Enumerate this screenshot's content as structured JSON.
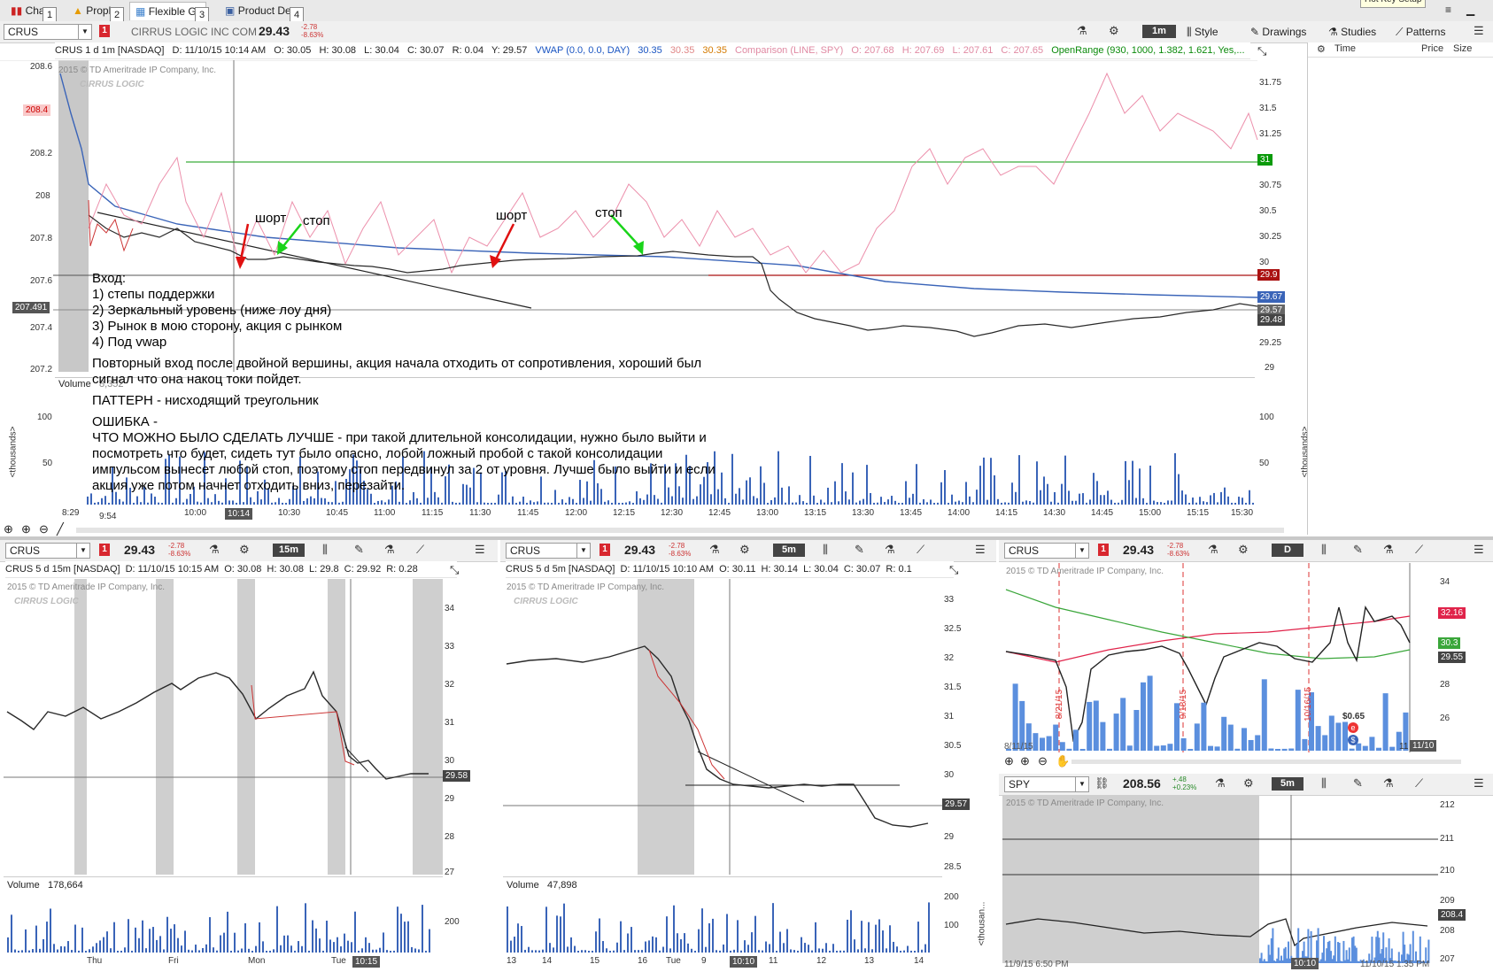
{
  "tabs": [
    {
      "label": "Char",
      "num": "1",
      "icon": "chart-icon"
    },
    {
      "label": "Proph",
      "num": "2",
      "icon": "warning-icon"
    },
    {
      "label": "Flexible Gr",
      "num": "3",
      "icon": "grid-icon"
    },
    {
      "label": "Product Dep",
      "num": "4",
      "icon": "book-icon"
    }
  ],
  "hotkey": "Hot Key Setup",
  "main": {
    "symbol": "CRUS",
    "alert_num": "1",
    "company": "CIRRUS LOGIC INC COM",
    "price": "29.43",
    "change": "-2.78",
    "change_pct": "-8.63%",
    "aggregation": "1m",
    "buttons": {
      "style": "Style",
      "drawings": "Drawings",
      "studies": "Studies",
      "patterns": "Patterns"
    },
    "info": {
      "desc": "CRUS 1 d 1m [NASDAQ]",
      "d": "D: 11/10/15 10:14 AM",
      "o": "O: 30.05",
      "h": "H: 30.08",
      "l": "L: 30.04",
      "c": "C: 30.07",
      "r": "R: 0.04",
      "y": "Y: 29.57",
      "vwap": "VWAP (0.0, 0.0, DAY)",
      "vwap1": "30.35",
      "vwap2": "30.35",
      "vwap3": "30.35",
      "comparison": "Comparison (LINE, SPY)",
      "co": "O: 207.68",
      "ch": "H: 207.69",
      "cl": "L: 207.61",
      "cc": "C: 207.65",
      "openrange": "OpenRange (930, 1000, 1.382, 1.621, Yes,..."
    },
    "copyright": "2015 © TD Ameritrade IP Company, Inc.",
    "logo": "CIRRUS LOGIC",
    "left_axis": [
      "208.6",
      "208.4",
      "208.2",
      "208",
      "207.8",
      "207.6",
      "207.491",
      "207.4",
      "207.2"
    ],
    "right_axis": [
      "31.75",
      "31.5",
      "31.25",
      "31",
      "30.75",
      "30.5",
      "30.25",
      "30",
      "29.9",
      "29.67",
      "29.57",
      "29.48",
      "29.25",
      "29"
    ],
    "time_axis": [
      "8:29",
      "9:54",
      "10:00",
      "10:14",
      "10:30",
      "10:45",
      "11:00",
      "11:15",
      "11:30",
      "11:45",
      "12:00",
      "12:15",
      "12:30",
      "12:45",
      "13:00",
      "13:15",
      "13:30",
      "13:45",
      "14:00",
      "14:15",
      "14:30",
      "14:45",
      "15:00",
      "15:15",
      "15:30"
    ],
    "volume_label": "Volume",
    "volume_value": "8,352",
    "volume_axis": [
      "100",
      "50"
    ],
    "thousands": "<thousands>",
    "annotations": {
      "short1": "шорт",
      "stop1": "стоп",
      "short2": "шорт",
      "stop2": "стоп"
    },
    "notes": [
      "Вход:",
      "1) степы поддержки",
      "2) Зеркальный уровень (ниже лоу дня)",
      "3) Рынок в мою сторону, акция с рынком",
      "4) Под vwap",
      "",
      "Повторный вход после двойной вершины, акция начала отходить от сопротивления, хороший был",
      "сигнал что она накоц токи пойдет.",
      "",
      "ПАТТЕРН - нисходящий треугольник",
      "",
      "ОШИБКА -",
      "ЧТО МОЖНО БЫЛО СДЕЛАТЬ ЛУЧШЕ - при такой длительной консолидации, нужно было выйти и",
      "посмотреть что будет, сидеть тут было опасно, лобой ложный пробой с такой консолидации",
      "импульсом вынесет любой стоп, поэтому стоп передвинул за 2 от уровня. Лучше было выйти и если",
      "акция уже потом начнет отходить вниз, перезайти."
    ]
  },
  "time_sales": {
    "time": "Time",
    "price": "Price",
    "size": "Size"
  },
  "chart15": {
    "symbol": "CRUS",
    "num": "1",
    "price": "29.43",
    "change": "-2.78",
    "change_pct": "-8.63%",
    "agg": "15m",
    "info": {
      "desc": "CRUS 5 d 15m [NASDAQ]",
      "d": "D: 11/10/15 10:15 AM",
      "o": "O: 30.08",
      "h": "H: 30.08",
      "l": "L: 29.8",
      "c": "C: 29.92",
      "r": "R: 0.28"
    },
    "copyright": "2015 © TD Ameritrade IP Company, Inc.",
    "logo": "CIRRUS LOGIC",
    "right_axis": [
      "34",
      "33",
      "32",
      "31",
      "30",
      "29.58",
      "29",
      "28",
      "27"
    ],
    "volume_label": "Volume",
    "volume_value": "178,664",
    "volume_axis": [
      "200"
    ],
    "time_axis": [
      "Thu",
      "Fri",
      "Mon",
      "Tue",
      "10:15"
    ]
  },
  "chart5": {
    "symbol": "CRUS",
    "num": "1",
    "price": "29.43",
    "change": "-2.78",
    "change_pct": "-8.63%",
    "agg": "5m",
    "info": {
      "desc": "CRUS 5 d 5m [NASDAQ]",
      "d": "D: 11/10/15 10:10 AM",
      "o": "O: 30.11",
      "h": "H: 30.14",
      "l": "L: 30.04",
      "c": "C: 30.07",
      "r": "R: 0.1"
    },
    "copyright": "2015 © TD Ameritrade IP Company, Inc.",
    "logo": "CIRRUS LOGIC",
    "right_axis": [
      "33",
      "32.5",
      "32",
      "31.5",
      "31",
      "30.5",
      "30",
      "29.57",
      "29",
      "28.5"
    ],
    "volume_label": "Volume",
    "volume_value": "47,898",
    "volume_axis": [
      "200",
      "100"
    ],
    "thousands": "<thousan...",
    "time_axis": [
      "13",
      "14",
      "15",
      "16",
      "Tue",
      "9",
      "10:10",
      "11",
      "12",
      "13",
      "14"
    ]
  },
  "chartD": {
    "symbol": "CRUS",
    "num": "1",
    "price": "29.43",
    "change": "-2.78",
    "change_pct": "-8.63%",
    "agg": "D",
    "copyright": "2015 © TD Ameritrade IP Company, Inc.",
    "right_axis": [
      "34",
      "32.16",
      "30.3",
      "29.55",
      "28",
      "26"
    ],
    "dates": [
      "8/21/15",
      "9/18/15",
      "10/16/15"
    ],
    "date_start": "8/11/15",
    "date_end": "11/10",
    "dividend": "$0.65",
    "short_day": "11"
  },
  "spy": {
    "symbol": "SPY",
    "price": "208.56",
    "change": "+.48",
    "change_pct": "+0.23%",
    "agg": "5m",
    "copyright": "2015 © TD Ameritrade IP Company, Inc.",
    "right_axis": [
      "212",
      "211",
      "210",
      "209",
      "208.4",
      "208",
      "207"
    ],
    "time_start": "11/9/15 6:50 PM",
    "time_cursor": "10:10",
    "time_end": "11/10/15 1:35 PM"
  }
}
